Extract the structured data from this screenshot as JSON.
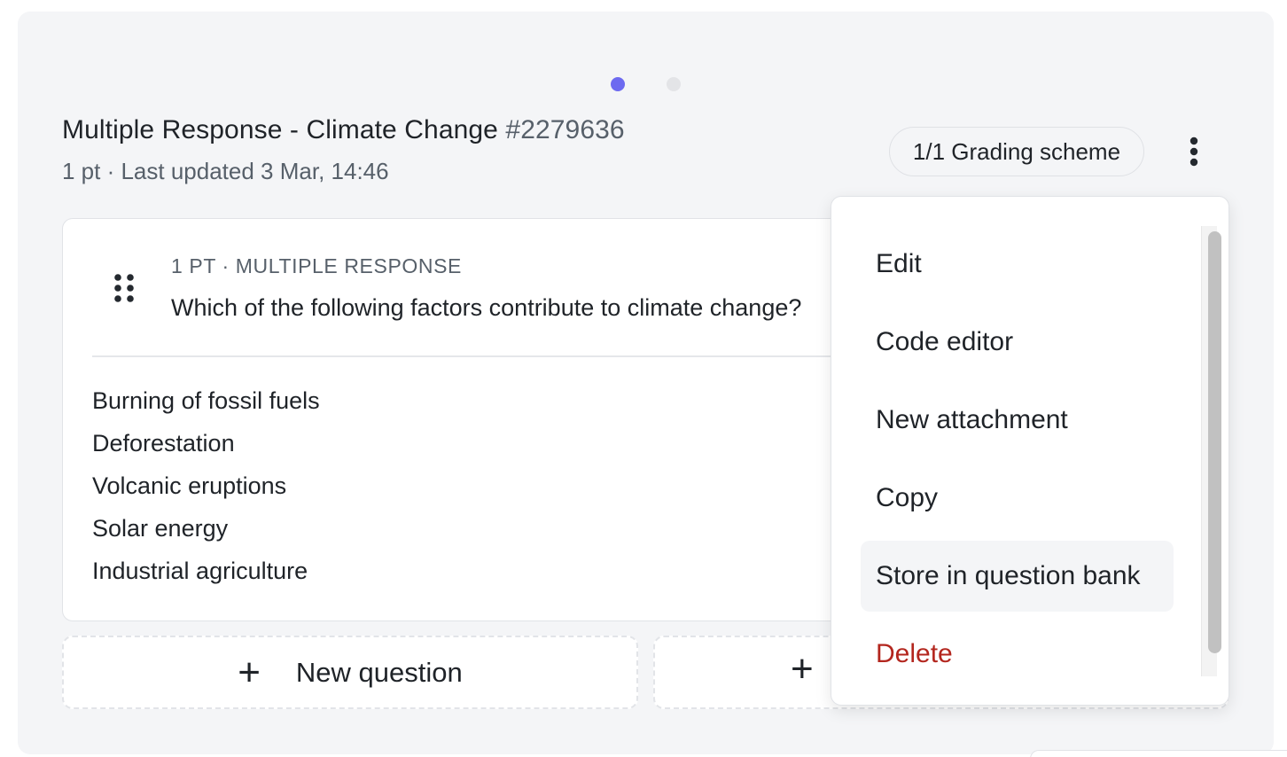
{
  "carousel": {
    "active_index": 0,
    "count": 2,
    "active_color": "#6d6af0"
  },
  "header": {
    "title": "Multiple Response - Climate Change",
    "question_id": "#2279636",
    "meta": "1 pt · Last updated 3 Mar, 14:46",
    "grading_scheme": "1/1 Grading scheme"
  },
  "question": {
    "meta": "1 PT · MULTIPLE RESPONSE",
    "text": "Which of the following factors contribute to climate change?",
    "options": [
      "Burning of fossil fuels",
      "Deforestation",
      "Volcanic eruptions",
      "Solar energy",
      "Industrial agriculture"
    ]
  },
  "actions": {
    "new_question": "New question"
  },
  "menu": {
    "items": [
      {
        "label": "Edit"
      },
      {
        "label": "Code editor"
      },
      {
        "label": "New attachment"
      },
      {
        "label": "Copy"
      },
      {
        "label": "Store in question bank",
        "hovered": true
      },
      {
        "label": "Delete",
        "danger": true
      }
    ],
    "danger_color": "#b3261e"
  },
  "icons": {
    "drag": "drag-handle-icon",
    "more": "more-vertical-icon",
    "add": "plus-icon"
  }
}
